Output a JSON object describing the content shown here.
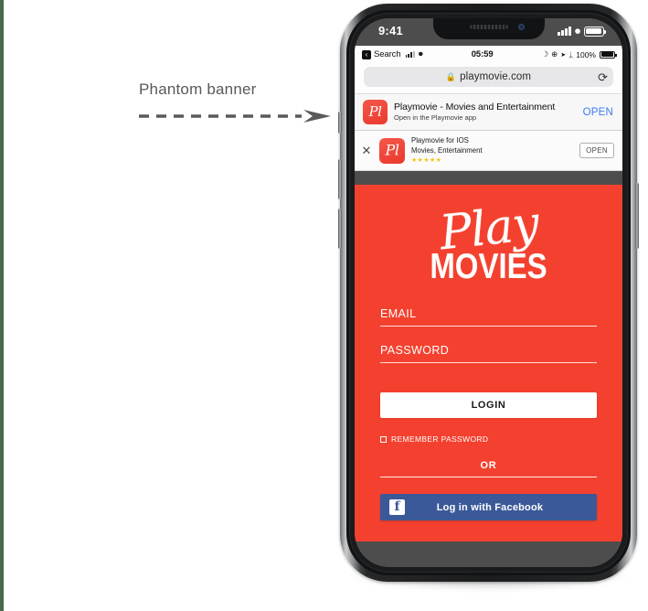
{
  "annotation": {
    "label": "Phantom banner",
    "arrow_icon": "dashed-arrow-right-icon",
    "color": "#58595b"
  },
  "device": {
    "frame_color": "#1a1b1d",
    "screen_bg": "#4d4d4d",
    "buttons": [
      "mute-switch",
      "volume-up",
      "volume-down",
      "power"
    ]
  },
  "ios_status_bar": {
    "time": "9:41",
    "signal_icon": "cellular-bars-icon",
    "wifi_icon": "wifi-icon",
    "battery_icon": "battery-full-icon"
  },
  "safari": {
    "status_bar": {
      "back_chip": "‹",
      "back_label": "Search",
      "signal_icon": "cellular-bars-icon",
      "wifi_icon": "wifi-icon",
      "time": "05:59",
      "do_not_disturb_icon": "☽",
      "orientation_lock_icon": "⊕",
      "location_icon": "➤",
      "bluetooth_icon": "ᛦ",
      "battery_percent": "100%",
      "battery_icon": "battery-full-icon"
    },
    "url_bar": {
      "lock_icon": "🔒",
      "url": "playmovie.com",
      "reload_icon": "⟳"
    }
  },
  "banner_smart_app": {
    "icon_name": "playmovie-app-icon",
    "icon_glyph": "Pl",
    "title": "Playmovie - Movies and Entertainment",
    "subtitle": "Open in the Playmovie app",
    "open_label": "OPEN",
    "open_color": "#3a7bf2"
  },
  "banner_phantom": {
    "close_icon": "✕",
    "icon_name": "playmovie-app-icon",
    "icon_glyph": "Pl",
    "title": "Playmovie for IOS",
    "subtitle": "Movies, Entertainment",
    "stars": "★★★★★",
    "star_color": "#f5c518",
    "open_label": "OPEN"
  },
  "app": {
    "background_color": "#f4412f",
    "logo": {
      "script_word": "Play",
      "block_word": "MOVIES"
    },
    "email_placeholder": "EMAIL",
    "password_placeholder": "PASSWORD",
    "email_value": "",
    "password_value": "",
    "login_label": "LOGIN",
    "remember_label": "REMEMBER PASSWORD",
    "remember_checked": false,
    "or_label": "OR",
    "facebook_label": "Log in with Facebook",
    "facebook_glyph": "f",
    "facebook_color": "#3b5998"
  }
}
